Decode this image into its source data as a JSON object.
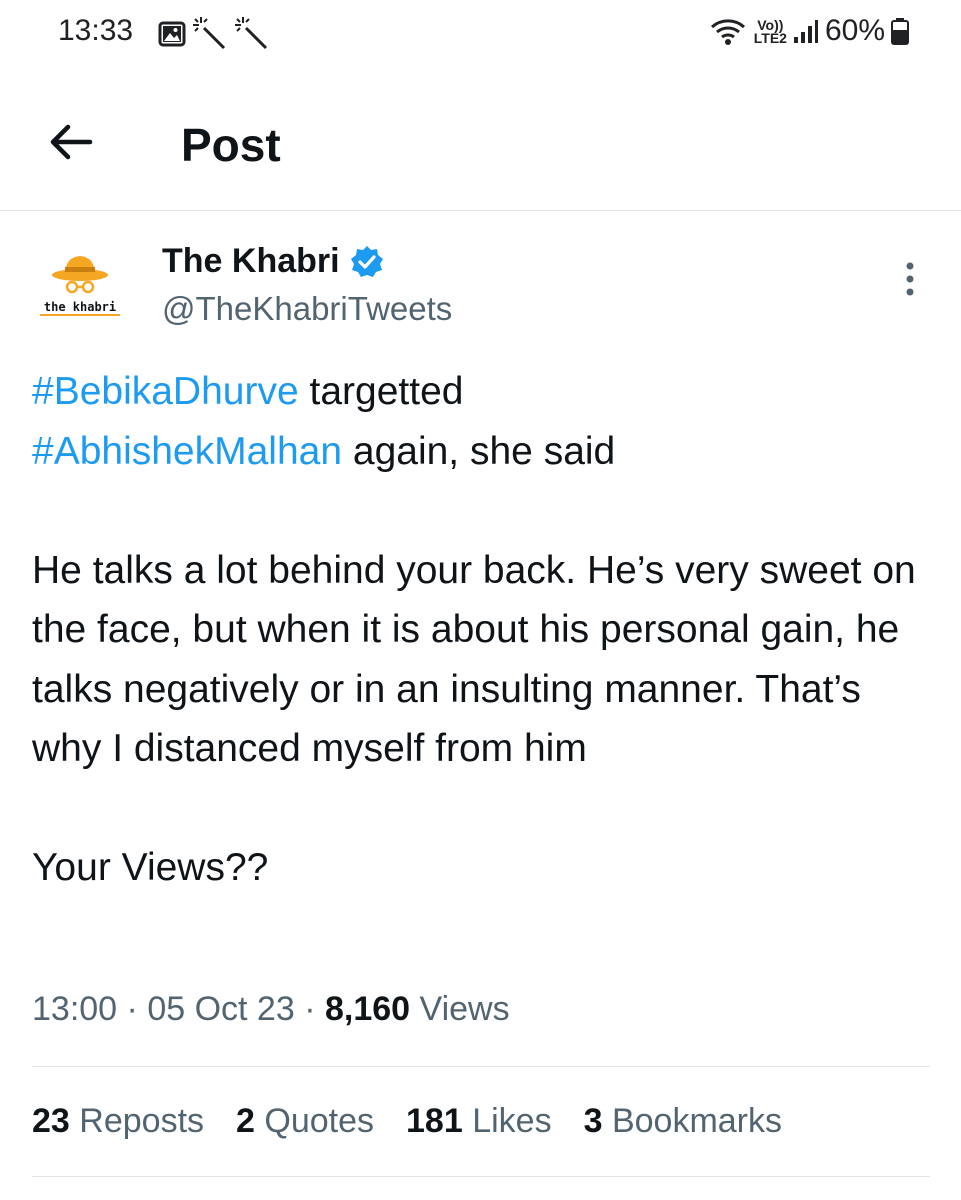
{
  "status_bar": {
    "time": "13:33",
    "icons_left": [
      "image-icon",
      "magic-wand-icon",
      "magic-wand-icon"
    ],
    "network_top": "Vo))",
    "network_bottom": "LTE2",
    "battery": "60%"
  },
  "header": {
    "title": "Post"
  },
  "post": {
    "author": {
      "name": "The Khabri",
      "handle": "@TheKhabriTweets",
      "avatar_text": "the khabri",
      "verified": true
    },
    "text": {
      "line1_hashtag": "#BebikaDhurve",
      "line1_rest": " targetted",
      "line2_hashtag": "#AbhishekMalhan",
      "line2_rest": " again, she said",
      "paragraph2": "He talks a lot behind your back. He’s very sweet on the face, but when it is about his personal gain, he talks negatively or in an insulting manner. That’s why I distanced myself from him",
      "paragraph3": "Your Views??"
    },
    "meta": {
      "time": "13:00",
      "separator": "·",
      "date": "05 Oct 23",
      "views_count": "8,160",
      "views_label": "Views"
    },
    "stats": [
      {
        "count": "23",
        "label": "Reposts"
      },
      {
        "count": "2",
        "label": "Quotes"
      },
      {
        "count": "181",
        "label": "Likes"
      },
      {
        "count": "3",
        "label": "Bookmarks"
      }
    ]
  },
  "colors": {
    "link": "#1d9bf0",
    "secondary_text": "#536471",
    "primary_text": "#0f1419",
    "verified": "#1d9bf0",
    "avatar_orange": "#f5a623"
  }
}
